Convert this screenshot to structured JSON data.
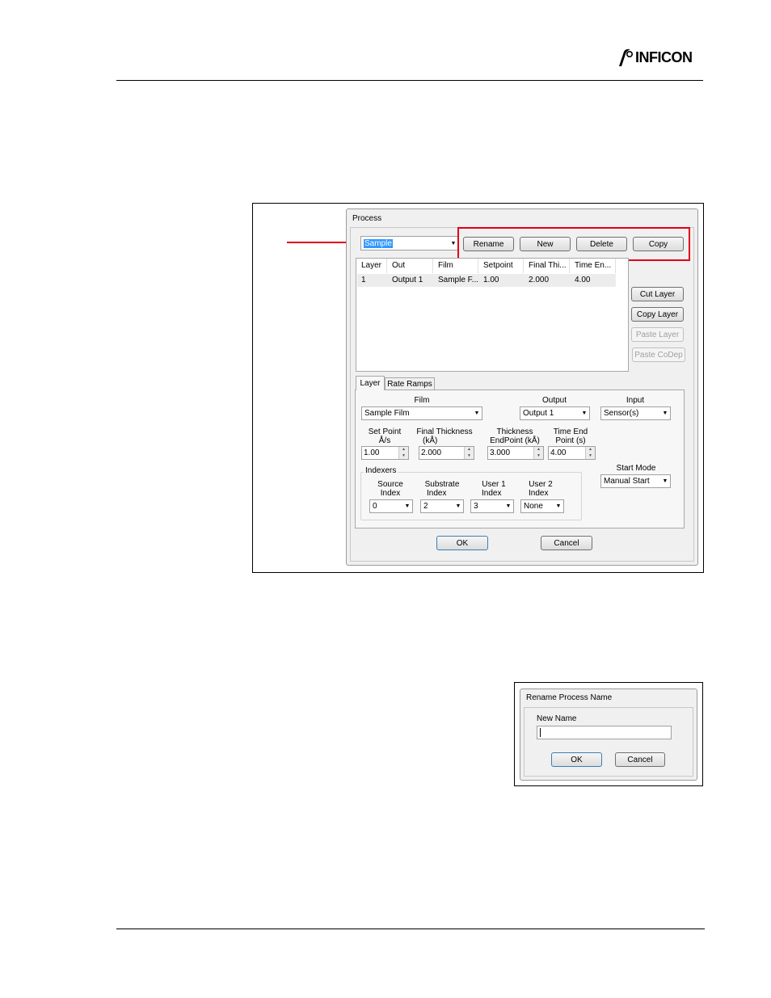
{
  "header": {
    "logo_text": "INFICON"
  },
  "process_dialog": {
    "title": "Process",
    "process_select": {
      "value": "Sample"
    },
    "buttons": {
      "rename": "Rename",
      "new": "New",
      "delete": "Delete",
      "copy": "Copy"
    },
    "layer_list": {
      "columns": [
        "Layer",
        "Out",
        "Film",
        "Setpoint",
        "Final Thi...",
        "Time En..."
      ],
      "rows": [
        [
          "1",
          "Output 1",
          "Sample F...",
          "1.00",
          "2.000",
          "4.00"
        ]
      ]
    },
    "side_buttons": {
      "cut": "Cut Layer",
      "copy": "Copy Layer",
      "paste": "Paste Layer",
      "paste_codep": "Paste CoDep"
    },
    "tabs": {
      "layer": "Layer",
      "rate_ramps": "Rate Ramps"
    },
    "layer_tab": {
      "film_label": "Film",
      "film_value": "Sample Film",
      "output_label": "Output",
      "output_value": "Output 1",
      "input_label": "Input",
      "input_value": "Sensor(s)",
      "setpoint_label_1": "Set Point",
      "setpoint_label_2": "Å/s",
      "setpoint_value": "1.00",
      "final_thickness_label_1": "Final Thickness",
      "final_thickness_label_2": "(kÅ)",
      "final_thickness_value": "2.000",
      "thickness_endpoint_label_1": "Thickness",
      "thickness_endpoint_label_2": "EndPoint (kÅ)",
      "thickness_endpoint_value": "3.000",
      "time_endpoint_label_1": "Time End",
      "time_endpoint_label_2": "Point (s)",
      "time_endpoint_value": "4.00",
      "indexers_label": "Indexers",
      "source_label_1": "Source",
      "source_label_2": "Index",
      "source_value": "0",
      "substrate_label_1": "Substrate",
      "substrate_label_2": "Index",
      "substrate_value": "2",
      "user1_label_1": "User 1",
      "user1_label_2": "Index",
      "user1_value": "3",
      "user2_label_1": "User 2",
      "user2_label_2": "Index",
      "user2_value": "None",
      "start_mode_label": "Start Mode",
      "start_mode_value": "Manual Start"
    },
    "ok": "OK",
    "cancel": "Cancel"
  },
  "rename_dialog": {
    "title": "Rename Process Name",
    "new_name_label": "New Name",
    "new_name_value": "",
    "ok": "OK",
    "cancel": "Cancel"
  },
  "colors": {
    "highlight_red": "#e0001a",
    "selection_blue": "#3399ff"
  }
}
